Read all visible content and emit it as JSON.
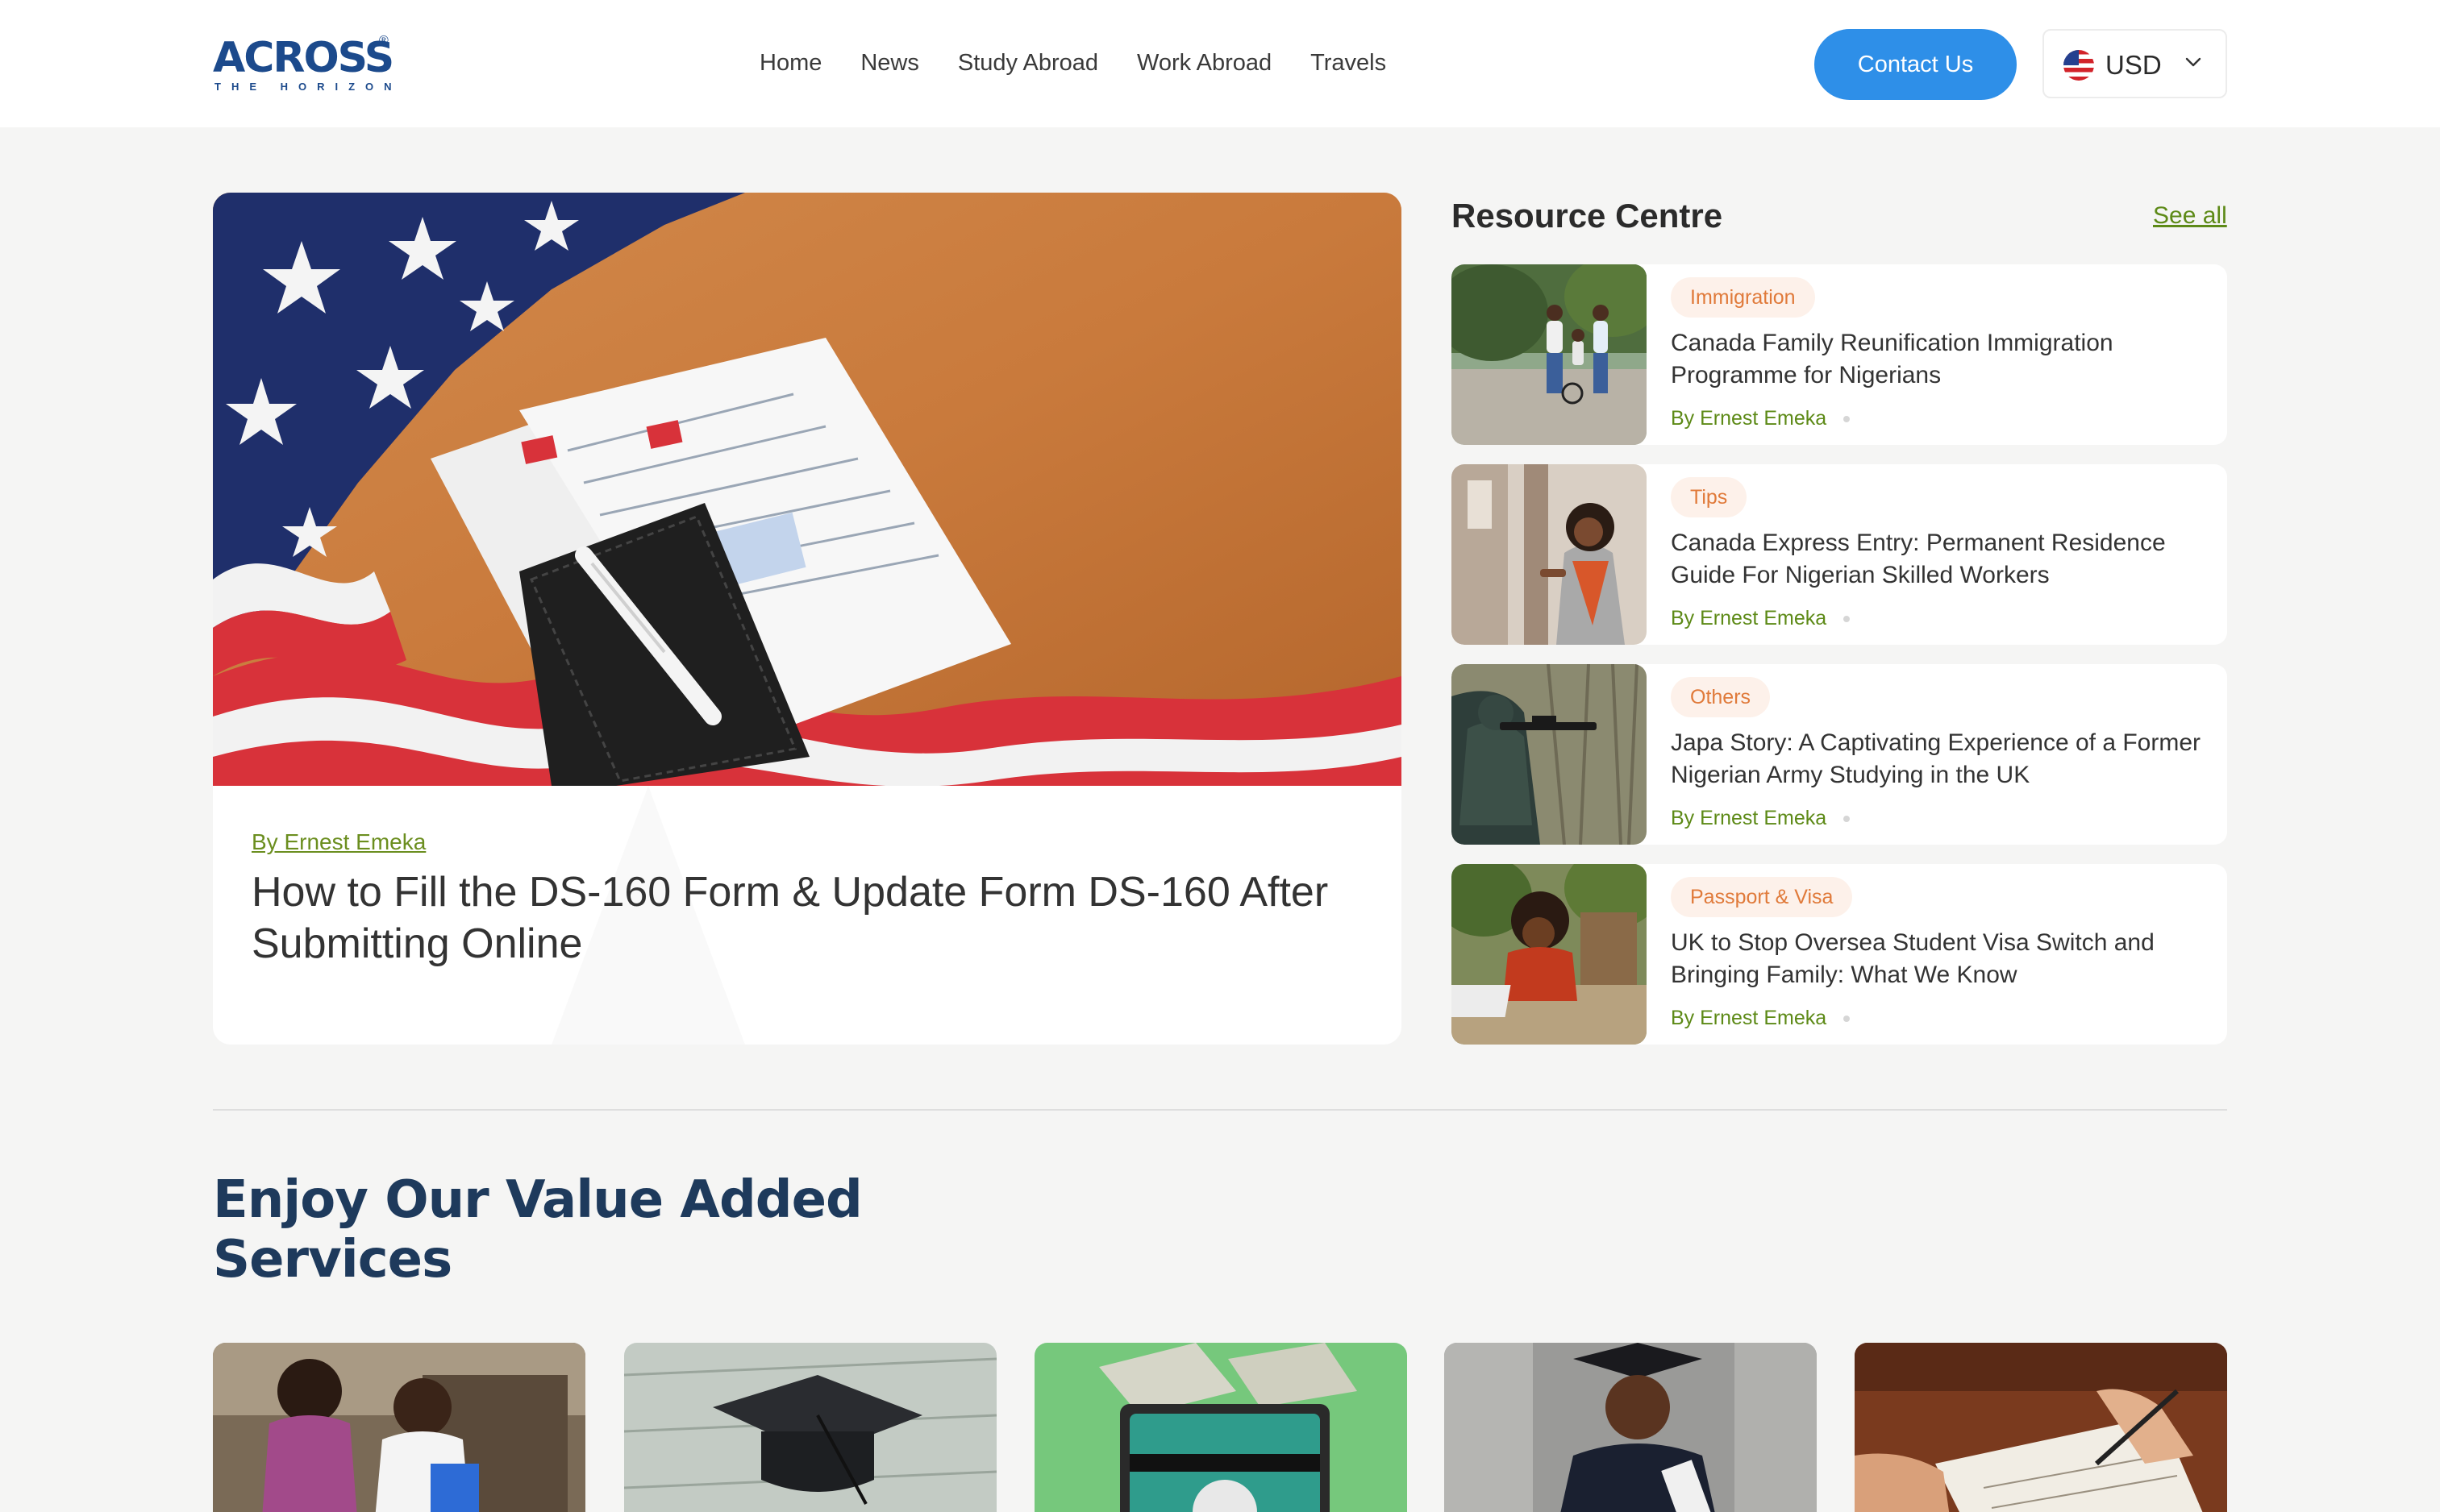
{
  "header": {
    "logo": {
      "wordmark": "ACROSS",
      "tagline": "THE HORIZON",
      "registered": "®"
    },
    "nav": [
      {
        "label": "Home"
      },
      {
        "label": "News"
      },
      {
        "label": "Study Abroad"
      },
      {
        "label": "Work Abroad"
      },
      {
        "label": "Travels"
      }
    ],
    "contact_label": "Contact Us",
    "currency": {
      "selected": "USD",
      "flag_icon": "us-flag-icon"
    }
  },
  "featured": {
    "byline": "By Ernest Emeka",
    "title": "How to Fill the DS-160 Form & Update Form DS-160 After Submitting Online"
  },
  "resource_centre": {
    "title": "Resource Centre",
    "see_all": "See all",
    "items": [
      {
        "tag": "Immigration",
        "headline": "Canada Family Reunification Immigration Programme for Nigerians",
        "author": "By Ernest Emeka"
      },
      {
        "tag": "Tips",
        "headline": "Canada Express Entry: Permanent Residence Guide For Nigerian Skilled Workers",
        "author": "By Ernest Emeka"
      },
      {
        "tag": "Others",
        "headline": "Japa Story: A Captivating Experience of a Former Nigerian Army Studying in the UK",
        "author": "By Ernest Emeka"
      },
      {
        "tag": "Passport & Visa",
        "headline": "UK to Stop Oversea Student Visa Switch and Bringing Family: What We Know",
        "author": "By Ernest Emeka"
      }
    ]
  },
  "services": {
    "title": "Enjoy Our Value Added Services"
  },
  "colors": {
    "brand_blue": "#1c4a8c",
    "accent_blue": "#2e8fe8",
    "author_green": "#5d8a17",
    "tag_orange": "#e07a3a",
    "services_heading": "#1e3a5c"
  }
}
